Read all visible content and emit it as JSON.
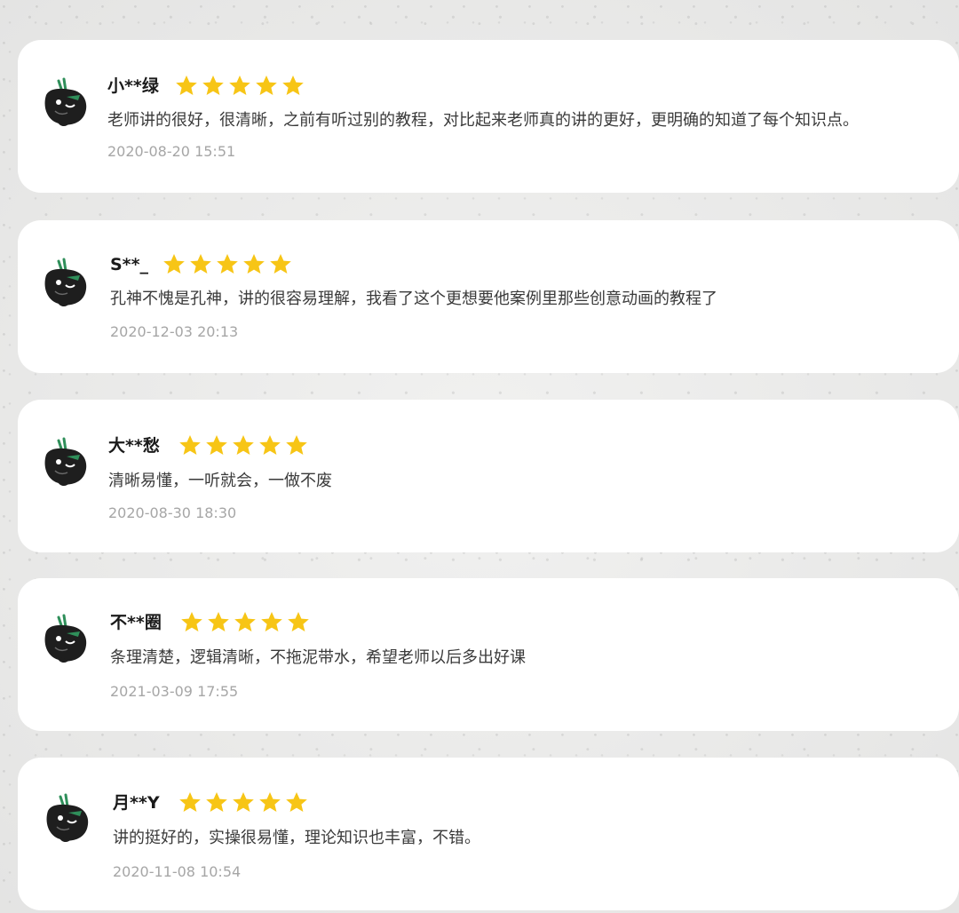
{
  "rating_color": "#f7c516",
  "reviews": [
    {
      "username": "小**绿",
      "stars": 5,
      "avatar_icon": "cartoon-avatar-icon",
      "comment": "老师讲的很好，很清晰，之前有听过别的教程，对比起来老师真的讲的更好，更明确的知道了每个知识点。",
      "time": "2020-08-20 15:51"
    },
    {
      "username": "S**_",
      "stars": 5,
      "avatar_icon": "cartoon-avatar-icon",
      "comment": "孔神不愧是孔神，讲的很容易理解，我看了这个更想要他案例里那些创意动画的教程了",
      "time": "2020-12-03 20:13"
    },
    {
      "username": "大**愁",
      "stars": 5,
      "avatar_icon": "cartoon-avatar-icon",
      "comment": "清晰易懂，一听就会，一做不废",
      "time": "2020-08-30 18:30"
    },
    {
      "username": "不**圈",
      "stars": 5,
      "avatar_icon": "cartoon-avatar-icon",
      "comment": "条理清楚，逻辑清晰，不拖泥带水，希望老师以后多出好课",
      "time": "2021-03-09 17:55"
    },
    {
      "username": "月**Y",
      "stars": 5,
      "avatar_icon": "cartoon-avatar-icon",
      "comment": "讲的挺好的，实操很易懂，理论知识也丰富，不错。",
      "time": "2020-11-08 10:54"
    }
  ]
}
